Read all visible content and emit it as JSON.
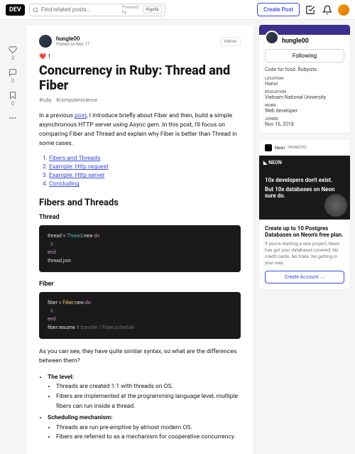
{
  "topbar": {
    "logo": "DEV",
    "search_placeholder": "Find related posts...",
    "powered": "Powered by",
    "algolia": "Algolia",
    "create": "Create Post"
  },
  "reactions": {
    "heart": "3",
    "comment": "0",
    "bookmark": "0"
  },
  "post": {
    "author": "hungle00",
    "date": "Posted on Nov 17",
    "admin": "Admin",
    "hearts": "❤️ 1",
    "title": "Concurrency in Ruby: Thread and Fiber",
    "tags": [
      "#ruby",
      "#computerscience"
    ],
    "intro_a": "In a previous ",
    "intro_link": "post",
    "intro_b": ", I introduce briefly about Fiber and then, build a simple asynchronous HTTP server using Async gem. In this post, I'll focus on comparing Fiber and Thread and explain why Fiber is better than Thread in some cases.",
    "toc": [
      "Fibers and Threads",
      "Example: Http request",
      "Example: Http server",
      "Concluding"
    ],
    "h2": "Fibers and Threads",
    "h3a": "Thread",
    "h3b": "Fiber",
    "code1": {
      "l1a": "thread = ",
      "l1b": "Thread",
      "l1c": ".new ",
      "l1d": "do",
      "l2": "  #...",
      "l3": "end",
      "l4": "thread.join"
    },
    "code2": {
      "l1a": "fiber = ",
      "l1b": "Fiber",
      "l1c": ".new ",
      "l1d": "do",
      "l2": "  #...",
      "l3": "end",
      "l4a": "fiber.resume ",
      "l4b": "# transfer / Fiber.schedule"
    },
    "para2": "As you can see, they have quite similar syntax, so what are the differences between them?",
    "b1": "The level:",
    "b1a": "Threads are created 1:1 with threads on OS.",
    "b1b": "Fibers are implemented at the programming language level, multiple fibers can run inside a thread.",
    "b2": "Scheduling mechanism:",
    "b2a": "Threads are run pre-emptive by almost modern OS.",
    "b2b": "Fibers are referred to as a mechanism for cooperative concurrency."
  },
  "profile": {
    "name": "hungle00",
    "follow": "Following",
    "bio": "Code for food. Rubyists.",
    "loc_l": "LOCATION",
    "loc": "Hanoi",
    "edu_l": "EDUCATION",
    "edu": "Vietnam National University",
    "work_l": "WORK",
    "work": "Web developer",
    "join_l": "JOINED",
    "join": "Nov 16, 2018"
  },
  "promo": {
    "brand": "Neon",
    "badge": "PROMOTED",
    "logo": "◣ NEON",
    "t1": "10x developers don't exist.",
    "t2": "But 10x databases on Neon sure do.",
    "title": "Create up to 10 Postgres Databases on Neon's free plan.",
    "desc": "If you're starting a new project, Neon has got your databases covered. No credit cards. No trials. No getting in your way.",
    "cta": "Create Account →"
  }
}
